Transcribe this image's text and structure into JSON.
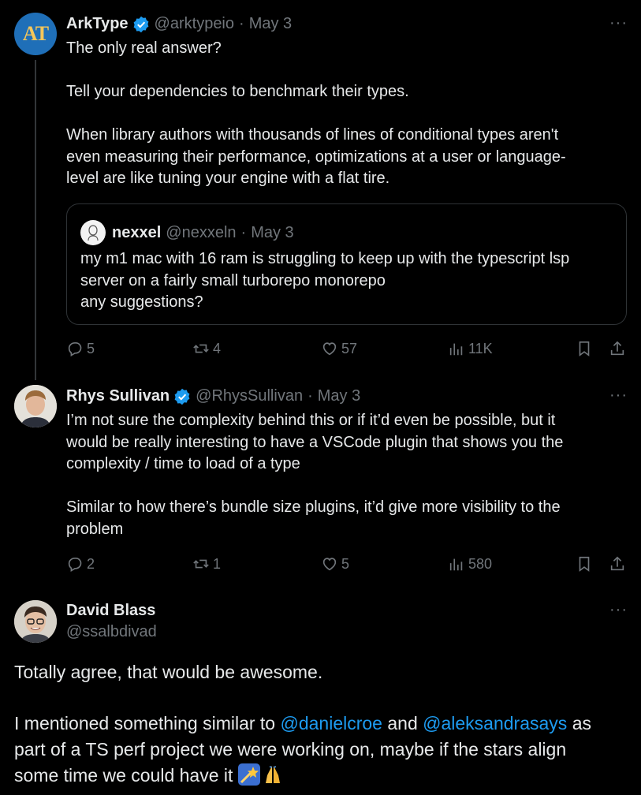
{
  "tweets": [
    {
      "name": "ArkType",
      "handle": "@arktypeio",
      "sep": "·",
      "date": "May 3",
      "avatar_text": "AT",
      "text": "The only real answer?\n\nTell your dependencies to benchmark their types.\n\nWhen library authors with thousands of lines of conditional types aren't\neven measuring their performance, optimizations at a user or language-\nlevel are like tuning your engine with a flat tire.",
      "quote": {
        "name": "nexxel",
        "handle": "@nexxeln",
        "sep": "·",
        "date": "May 3",
        "text": "my m1 mac with 16 ram is struggling to keep up with the typescript lsp\nserver on a fairly small turborepo monorepo\nany suggestions?"
      },
      "replies": "5",
      "reposts": "4",
      "likes": "57",
      "views": "11K"
    },
    {
      "name": "Rhys Sullivan",
      "handle": "@RhysSullivan",
      "sep": "·",
      "date": "May 3",
      "text": "I’m not sure the complexity behind this or if it’d even be possible, but it\nwould be really interesting to have a VSCode plugin that shows you the\ncomplexity / time to load of a type\n\nSimilar to how there’s bundle size plugins, it’d give more visibility to the\nproblem",
      "replies": "2",
      "reposts": "1",
      "likes": "5",
      "views": "580"
    },
    {
      "name": "David Blass",
      "handle": "@ssalbdivad",
      "line1": "Totally agree, that would be awesome.",
      "line2_a": "I mentioned something similar to ",
      "mention1": "@danielcroe",
      "line2_b": " and ",
      "mention2": "@aleksandrasays",
      "line2_c": " as",
      "line3": "part of a TS perf project we were working on, maybe if the stars align",
      "line4": "some time we could have it "
    }
  ],
  "icons": {
    "more": "more-icon",
    "verified": "verified-badge-icon",
    "reply": "reply-icon",
    "repost": "repost-icon",
    "like": "like-icon",
    "views": "views-icon",
    "bookmark": "bookmark-icon",
    "share": "share-icon"
  },
  "colors": {
    "background": "#000000",
    "text": "#e7e9ea",
    "secondary": "#71767b",
    "link": "#1d9bf0",
    "verified": "#1d9bf0",
    "arktype_avatar": "#1f6fb8",
    "arktype_letters": "#f5c65a"
  }
}
